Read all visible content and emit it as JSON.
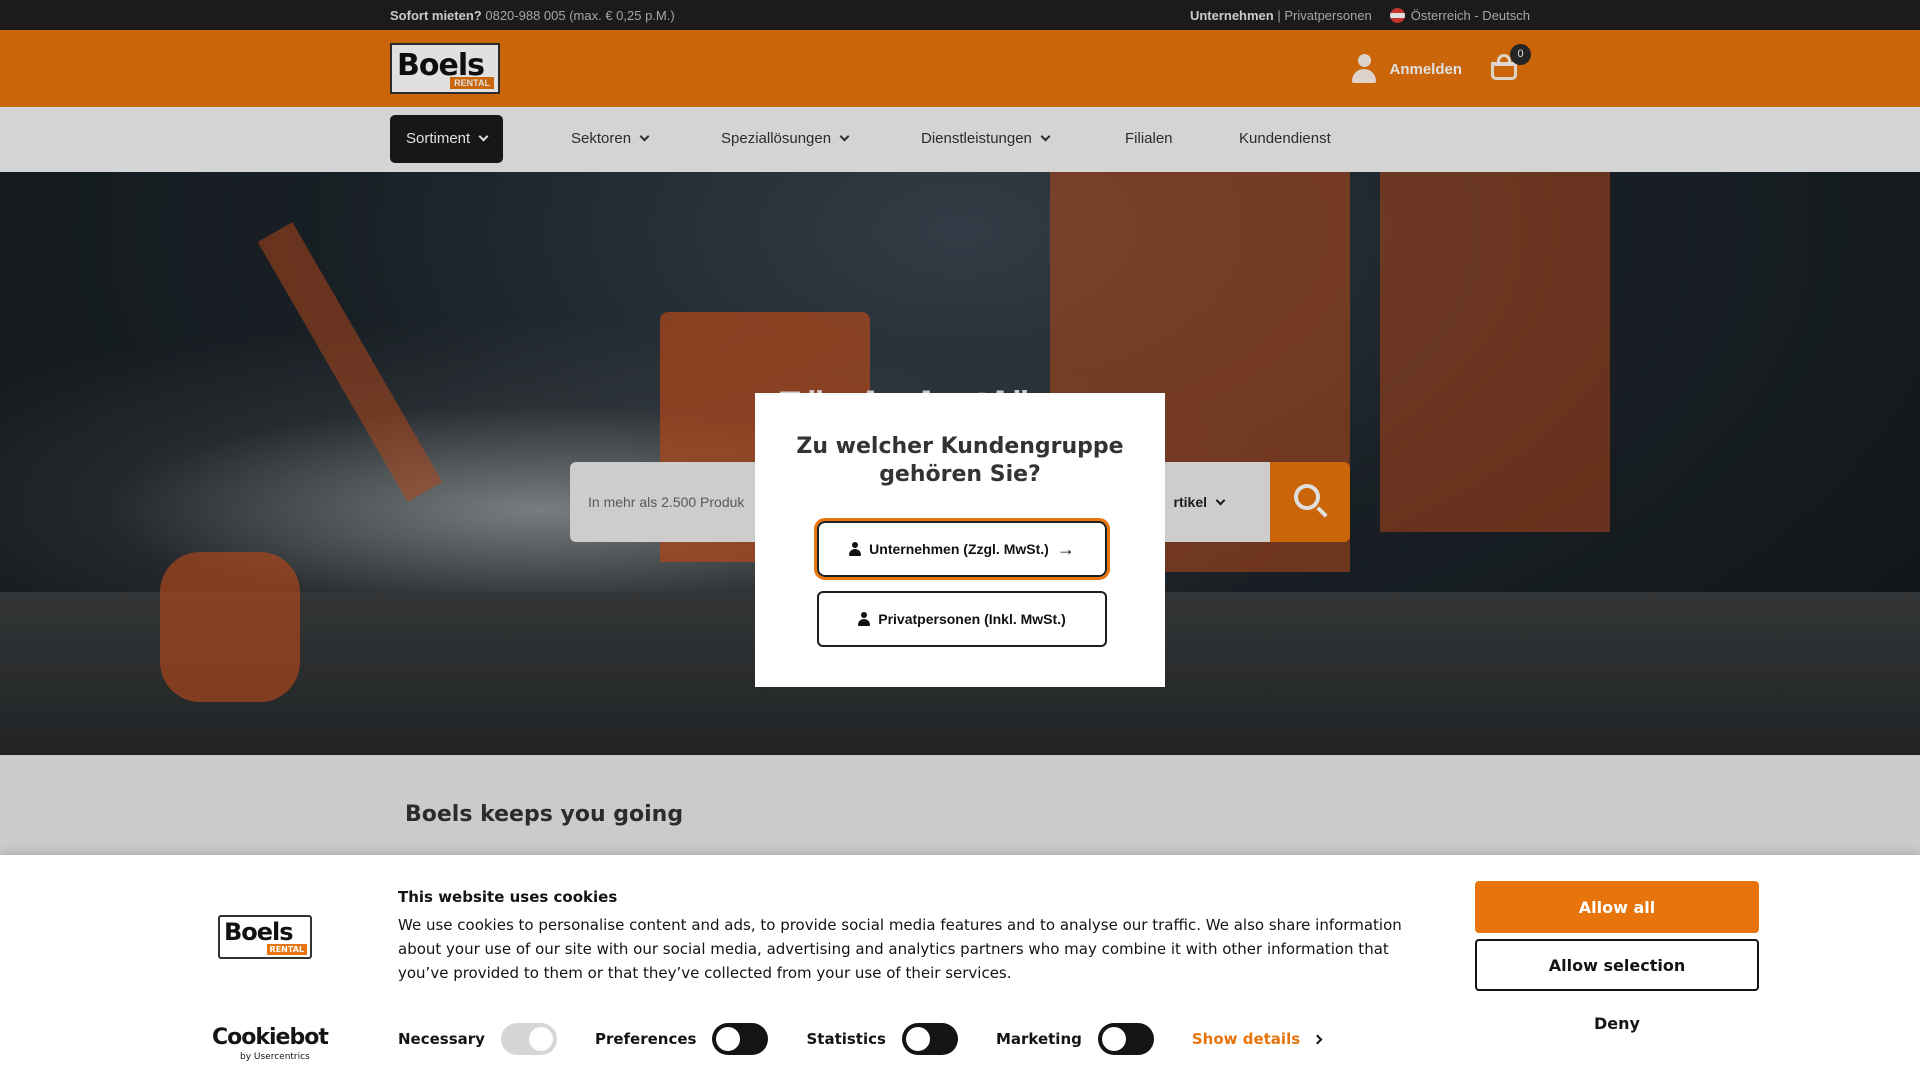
{
  "topbar": {
    "rent_now_label": "Sofort mieten?",
    "rent_now_phone": "0820-988 005 (max. € 0,25 p.M.)",
    "segment_business": "Unternehmen",
    "segment_separator": " | ",
    "segment_private": "Privatpersonen",
    "locale": "Österreich - Deutsch"
  },
  "header": {
    "logo_text": "Boels",
    "logo_sub": "RENTAL",
    "login_label": "Anmelden",
    "cart_count": "0"
  },
  "nav": {
    "items": [
      {
        "label": "Sortiment"
      },
      {
        "label": "Sektoren"
      },
      {
        "label": "Speziallösungen"
      },
      {
        "label": "Dienstleistungen"
      },
      {
        "label": "Filialen"
      },
      {
        "label": "Kundendienst"
      }
    ]
  },
  "hero": {
    "title": "Für jede                                             tlösung",
    "search_placeholder": "In mehr als 2.500 Produk",
    "search_category": "rtikel"
  },
  "section": {
    "heading": "Boels keeps you going"
  },
  "modal": {
    "title": "Zu welcher Kundengruppe gehören Sie?",
    "business_button": "Unternehmen (Zzgl. MwSt.)",
    "private_button": "Privatpersonen (Inkl. MwSt.)"
  },
  "cookie": {
    "title": "This website uses cookies",
    "text": "We use cookies to personalise content and ads, to provide social media features and to analyse our traffic. We also share information about your use of our site with our social media, advertising and analytics partners who may combine it with other information that you’ve provided to them or that they’ve collected from your use of their services.",
    "toggles": [
      {
        "label": "Necessary"
      },
      {
        "label": "Preferences"
      },
      {
        "label": "Statistics"
      },
      {
        "label": "Marketing"
      }
    ],
    "show_details": "Show details",
    "allow_all": "Allow all",
    "allow_selection": "Allow selection",
    "deny": "Deny",
    "brand": "Cookiebot",
    "brand_sub": "by Usercentrics"
  },
  "colors": {
    "accent": "#e8740c",
    "dark": "#1f1f1f"
  }
}
